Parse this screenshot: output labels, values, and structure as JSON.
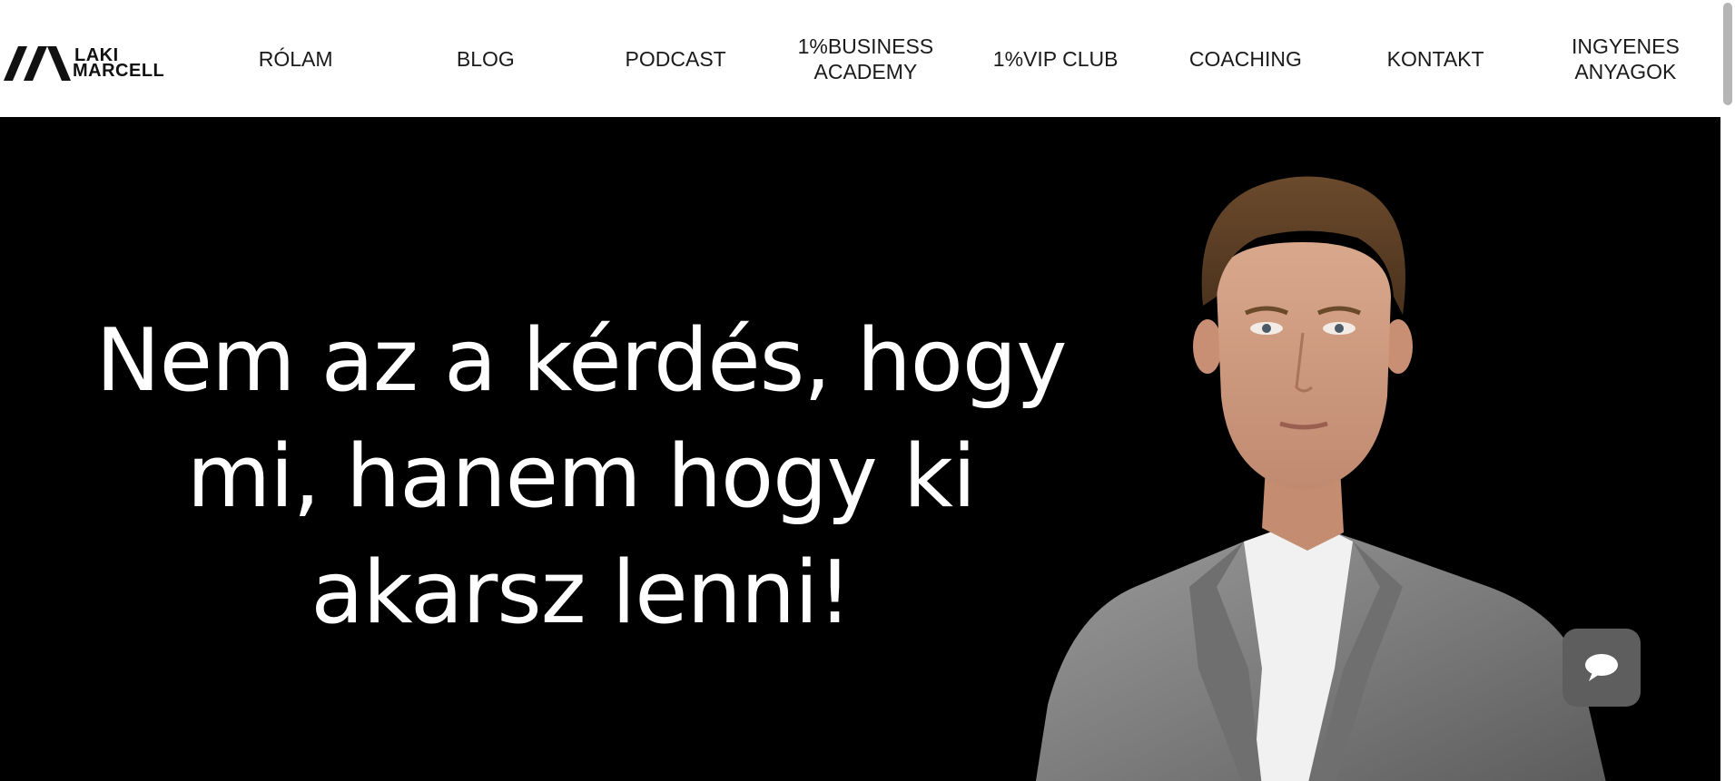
{
  "brand": {
    "logo_line1": "LAKI",
    "logo_line2": "MARCELL"
  },
  "nav": {
    "items": [
      {
        "label": "RÓLAM"
      },
      {
        "label": "BLOG"
      },
      {
        "label": "PODCAST"
      },
      {
        "label": "1%BUSINESS\nACADEMY"
      },
      {
        "label": "1%VIP CLUB"
      },
      {
        "label": "COACHING"
      },
      {
        "label": "KONTAKT"
      },
      {
        "label": "INGYENES\nANYAGOK"
      }
    ]
  },
  "hero": {
    "headline": "Nem az a kérdés, hogy mi, hanem hogy ki akarsz lenni!",
    "background_color": "#000000",
    "text_color": "#ffffff"
  },
  "chat": {
    "icon": "chat-bubble-icon",
    "color": "#5e5e5e"
  }
}
